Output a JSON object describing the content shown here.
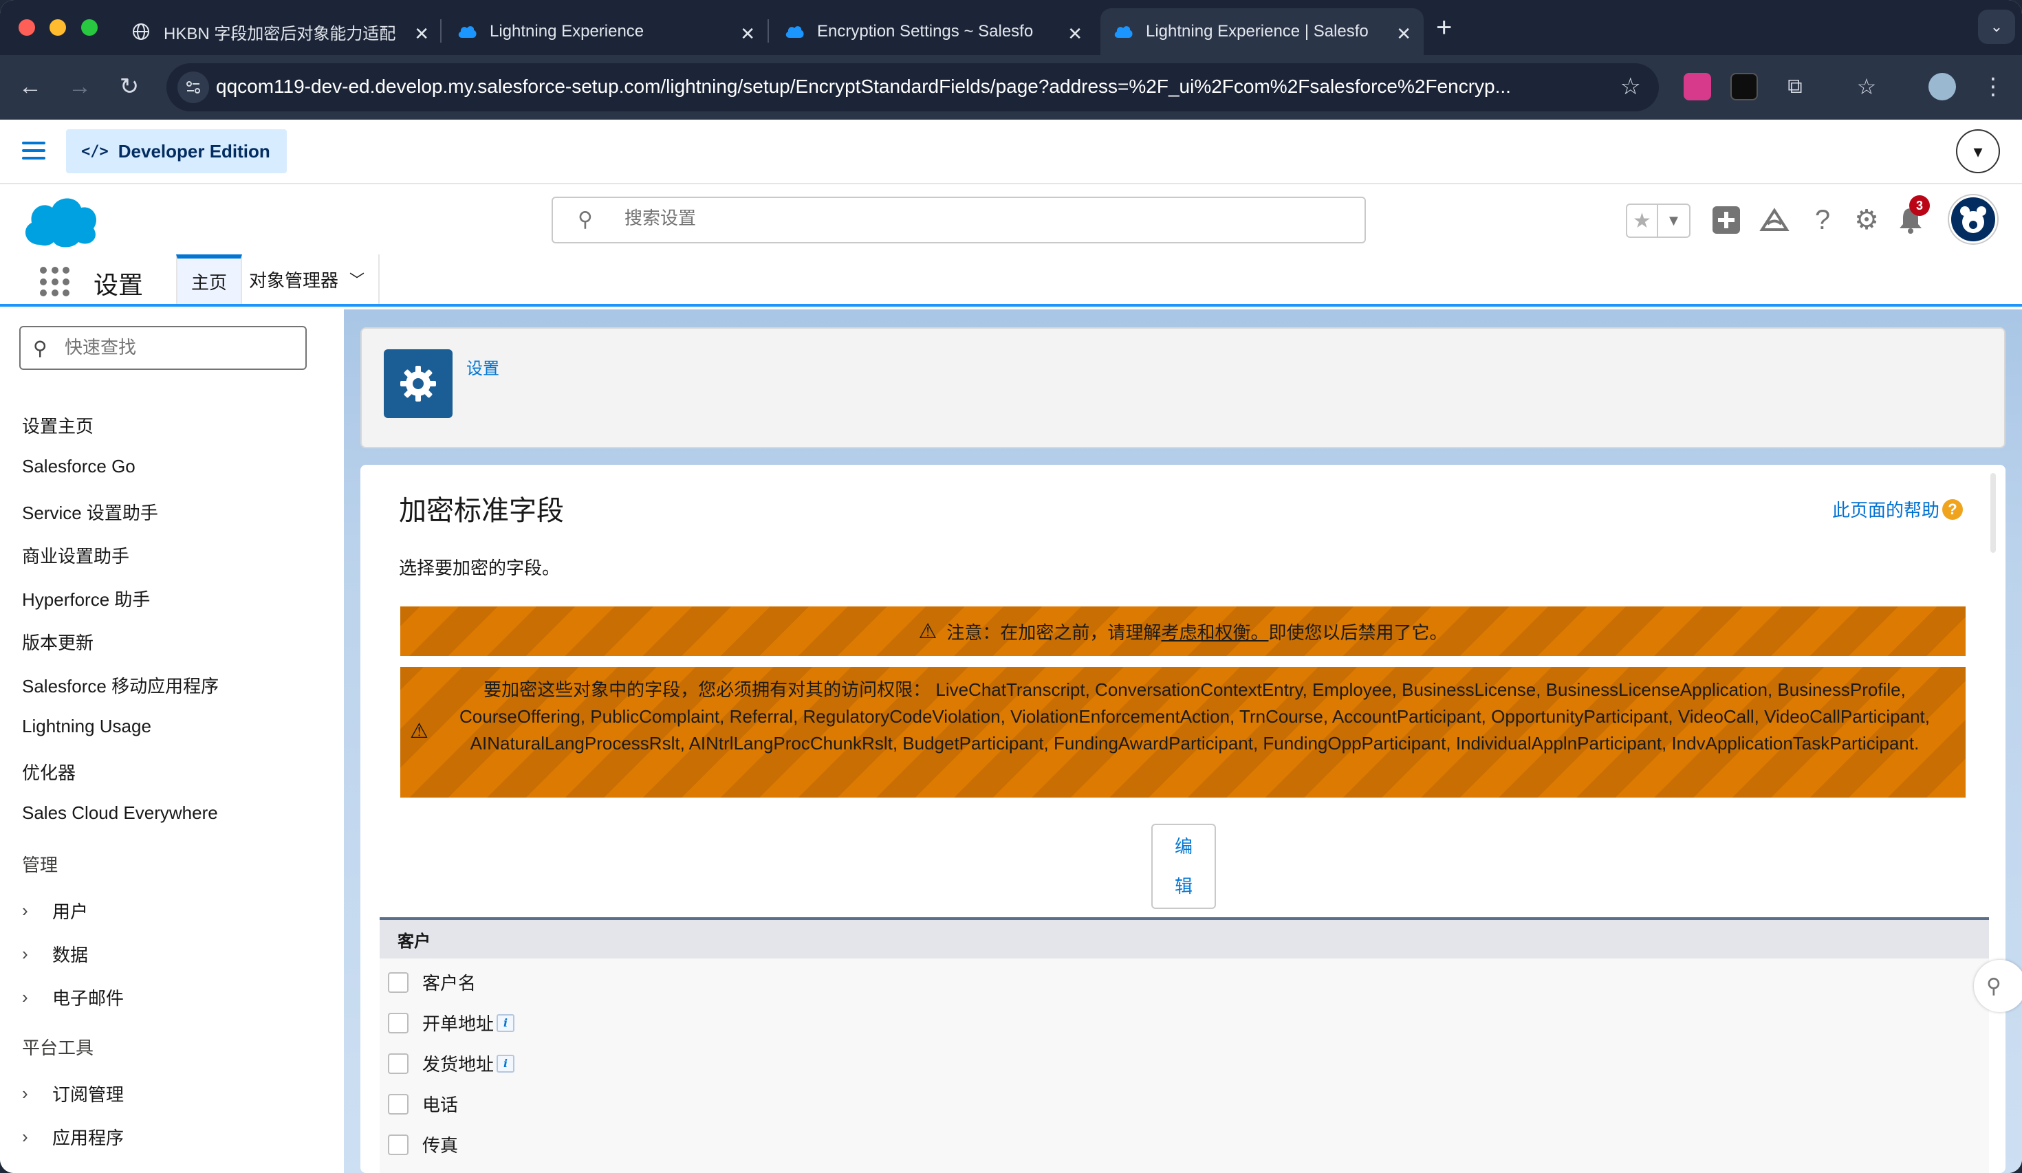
{
  "browser": {
    "tabs": [
      {
        "title": "HKBN 字段加密后对象能力适配",
        "active": false
      },
      {
        "title": "Lightning Experience",
        "active": false
      },
      {
        "title": "Encryption Settings ~ Salesfo",
        "active": false
      },
      {
        "title": "Lightning Experience | Salesfo",
        "active": true
      }
    ],
    "url": "qqcom119-dev-ed.develop.my.salesforce-setup.com/lightning/setup/EncryptStandardFields/page?address=%2F_ui%2Fcom%2Fsalesforce%2Fencryp..."
  },
  "sf": {
    "edition_badge": "Developer Edition",
    "search_placeholder": "搜索设置",
    "notification_count": "3",
    "app_name": "设置",
    "nav_tabs": {
      "home": "主页",
      "object_manager": "对象管理器"
    }
  },
  "sidebar": {
    "quickfind_placeholder": "快速查找",
    "items": [
      "设置主页",
      "Salesforce Go",
      "Service 设置助手",
      "商业设置助手",
      "Hyperforce 助手",
      "版本更新",
      "Salesforce 移动应用程序",
      "Lightning Usage",
      "优化器",
      "Sales Cloud Everywhere"
    ],
    "section_admin": "管理",
    "admin_items": [
      "用户",
      "数据",
      "电子邮件"
    ],
    "section_platform": "平台工具",
    "platform_items": [
      "订阅管理",
      "应用程序"
    ]
  },
  "main": {
    "breadcrumb": "设置",
    "page_title": "加密标准字段",
    "help_link": "此页面的帮助",
    "subtitle": "选择要加密的字段。",
    "warning1": {
      "prefix": "注意：在加密之前，请理解",
      "link": "考虑和权衡。",
      "suffix": " 即使您以后禁用了它。"
    },
    "warning2": "要加密这些对象中的字段，您必须拥有对其的访问权限： LiveChatTranscript, ConversationContextEntry, Employee, BusinessLicense, BusinessLicenseApplication, BusinessProfile, CourseOffering, PublicComplaint, Referral, RegulatoryCodeViolation, ViolationEnforcementAction, TrnCourse, AccountParticipant, OpportunityParticipant, VideoCall, VideoCallParticipant, AINaturalLangProcessRslt, AINtrlLangProcChunkRslt, BudgetParticipant, FundingAwardParticipant, FundingOppParticipant, IndividualApplnParticipant, IndvApplicationTaskParticipant.",
    "edit_button": {
      "line1": "编",
      "line2": "辑"
    },
    "object_section": {
      "title": "客户",
      "fields": [
        {
          "label": "客户名",
          "info": false
        },
        {
          "label": "开单地址",
          "info": true
        },
        {
          "label": "发货地址",
          "info": true
        },
        {
          "label": "电话",
          "info": false
        },
        {
          "label": "传真",
          "info": false
        }
      ]
    }
  },
  "colors": {
    "brand_blue": "#0176d3",
    "warning_orange": "#dd7a01",
    "browser_chrome": "#1c2537"
  }
}
